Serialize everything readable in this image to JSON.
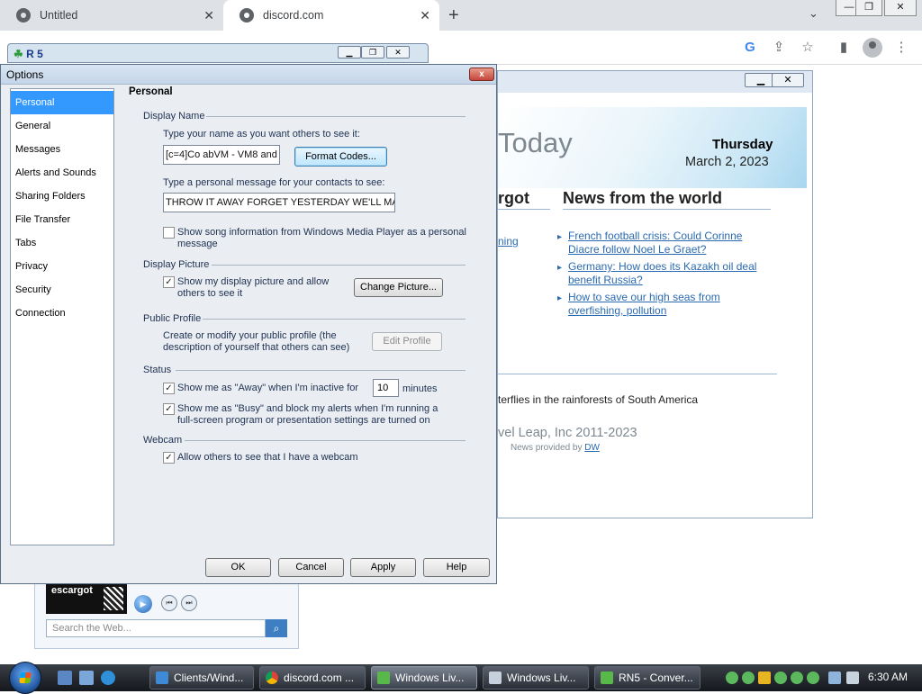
{
  "browser": {
    "tabs": [
      {
        "title": "Untitled"
      },
      {
        "title": "discord.com"
      }
    ],
    "new_tab": "+",
    "window_controls": {
      "minimize": "—",
      "restore": "❐",
      "close": "✕"
    }
  },
  "messenger": {
    "logo_text": "R 5"
  },
  "today": {
    "heading": "Today",
    "day": "Thursday",
    "date": "March 2, 2023",
    "left_heading": "rgot",
    "left_link": "ning",
    "news_heading": "News from the world",
    "news": [
      {
        "text": "French football crisis: Could Corinne Diacre follow Noel Le Graet?"
      },
      {
        "text": "Germany: How does its Kazakh oil deal benefit Russia?"
      },
      {
        "text": "How to save our high seas from overfishing, pollution"
      }
    ],
    "butterfly": "terflies in the rainforests of South America",
    "copyright": "vel Leap, Inc 2011-2023",
    "provided_label": "News provided by",
    "provided_link": "DW"
  },
  "messenger_bottom": {
    "thumb_text": "escargot",
    "search_placeholder": "Search the Web..."
  },
  "dialog": {
    "title": "Options",
    "close": "x",
    "nav": [
      {
        "label": "Personal"
      },
      {
        "label": "General"
      },
      {
        "label": "Messages"
      },
      {
        "label": "Alerts and Sounds"
      },
      {
        "label": "Sharing Folders"
      },
      {
        "label": "File Transfer"
      },
      {
        "label": "Tabs"
      },
      {
        "label": "Privacy"
      },
      {
        "label": "Security"
      },
      {
        "label": "Connection"
      }
    ],
    "heading": "Personal",
    "display_name": {
      "group": "Display Name",
      "prompt": "Type your name as you want others to see it:",
      "value": "[c=4]Co  abVM - VM8 and ",
      "format_codes": "Format Codes...",
      "message_prompt": "Type a personal message for your contacts to see:",
      "message_value": "THROW IT AWAY FORGET YESTERDAY WE'LL MA",
      "song_option": "Show song information from Windows Media Player as a personal",
      "song_option_2": "message",
      "song_checked": false
    },
    "display_picture": {
      "group": "Display Picture",
      "option": "Show my display picture and allow",
      "option_2": "others to see it",
      "checked": true,
      "change": "Change Picture..."
    },
    "public_profile": {
      "group": "Public Profile",
      "text": "Create or modify your public profile (the",
      "text_2": "description of yourself that others can see)",
      "edit": "Edit Profile"
    },
    "status": {
      "group": "Status",
      "away": "Show me as \"Away\" when I'm inactive for",
      "away_minutes": "10",
      "minutes_label": "minutes",
      "away_checked": true,
      "busy": "Show me as \"Busy\" and block my alerts when I'm running a",
      "busy_2": "full-screen program or presentation settings are turned on",
      "busy_checked": true
    },
    "webcam": {
      "group": "Webcam",
      "option": "Allow others to see that I have a webcam",
      "checked": true
    },
    "buttons": {
      "ok": "OK",
      "cancel": "Cancel",
      "apply": "Apply",
      "help": "Help"
    }
  },
  "taskbar": {
    "items": [
      {
        "label": "Clients/Wind..."
      },
      {
        "label": "discord.com ..."
      },
      {
        "label": "Windows Liv..."
      },
      {
        "label": "Windows Liv..."
      },
      {
        "label": "RN5 - Conver..."
      }
    ],
    "clock": "6:30 AM"
  }
}
